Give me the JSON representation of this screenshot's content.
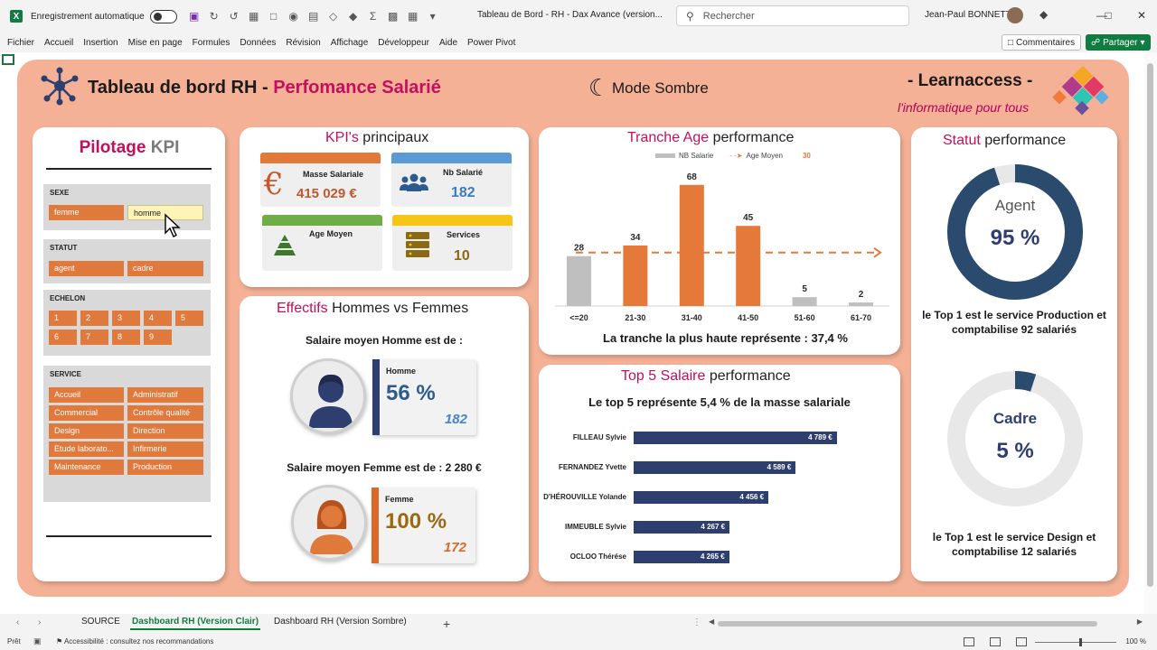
{
  "titlebar": {
    "autosave_label": "Enregistrement automatique",
    "doc_title": "Tableau de Bord - RH - Dax Avance (version...",
    "search_placeholder": "Rechercher",
    "user_name": "Jean-Paul BONNETTO"
  },
  "menu": {
    "items": [
      "Fichier",
      "Accueil",
      "Insertion",
      "Mise en page",
      "Formules",
      "Données",
      "Révision",
      "Affichage",
      "Développeur",
      "Aide",
      "Power Pivot"
    ],
    "comments_label": "Commentaires",
    "share_label": "Partager"
  },
  "header": {
    "title_main": "Tableau de bord RH - ",
    "title_accent": "Perfomance Salarié",
    "mode_label": "Mode Sombre",
    "brand_name": "- Learnaccess -",
    "brand_tagline": "l'informatique pour tous"
  },
  "pilotage": {
    "title_a": "Pilotage",
    "title_b": "KPI",
    "sexe": {
      "label": "SEXE",
      "options": [
        "femme",
        "homme"
      ],
      "selected": "homme"
    },
    "statut": {
      "label": "STATUT",
      "options": [
        "agent",
        "cadre"
      ]
    },
    "echelon": {
      "label": "ECHELON",
      "options": [
        "1",
        "2",
        "3",
        "4",
        "5",
        "6",
        "7",
        "8",
        "9"
      ]
    },
    "service": {
      "label": "SERVICE",
      "options": [
        "Accueil",
        "Administratif",
        "Commercial",
        "Contrôle qualité",
        "Design",
        "Direction",
        "Etude laborato...",
        "Infirmerie",
        "Maintenance",
        "Production"
      ]
    }
  },
  "kpi": {
    "title_a": "KPI's",
    "title_b": "principaux",
    "masse_label": "Masse Salariale",
    "masse_value": "415 029 €",
    "nb_label": "Nb Salarié",
    "nb_value": "182",
    "age_label": "Age Moyen",
    "services_label": "Services",
    "services_value": "10",
    "colors": {
      "masse": "#e0793a",
      "nb": "#5b9bd5",
      "age": "#70ad47",
      "services": "#f5c518"
    }
  },
  "effectifs": {
    "title_a": "Effectifs",
    "title_b": "Hommes vs Femmes",
    "homme_caption": "Salaire moyen Homme est de :",
    "femme_caption": "Salaire moyen Femme est de : 2 280 €",
    "homme_label": "Homme",
    "homme_pct": "56 %",
    "homme_count": "182",
    "femme_label": "Femme",
    "femme_pct": "100 %",
    "femme_count": "172"
  },
  "tranche": {
    "title_a": "Tranche Age",
    "title_b": "performance",
    "caption": "La tranche la plus haute représente : 37,4 %"
  },
  "top5": {
    "title_a": "Top 5 Salaire",
    "title_b": "performance",
    "subtitle": "Le top 5 représente 5,4 % de la masse salariale"
  },
  "statut": {
    "title_a": "Statut",
    "title_b": "performance",
    "agent_label": "Agent",
    "agent_pct": "95 %",
    "agent_caption_1": "le Top 1 est le service Production et",
    "agent_caption_2": "comptabilise 92 salariés",
    "cadre_label": "Cadre",
    "cadre_pct": "5 %",
    "cadre_caption_1": "le Top 1 est le service Design et",
    "cadre_caption_2": "comptabilise 12 salariés",
    "agent_fraction": 0.95,
    "cadre_fraction": 0.05
  },
  "chart_data": [
    {
      "type": "bar",
      "categories": [
        "<=20",
        "21-30",
        "31-40",
        "41-50",
        "51-60",
        "61-70"
      ],
      "series": [
        {
          "name": "NB Salarie",
          "values": [
            28,
            34,
            68,
            45,
            5,
            2
          ]
        },
        {
          "name": "Age Moyen",
          "values": [
            30,
            30,
            30,
            30,
            30,
            30
          ],
          "type": "line"
        }
      ],
      "legend": {
        "bar_label": "NB Salarie",
        "line_label": "Age Moyen",
        "line_value": "30"
      },
      "bar_colors": [
        "#bfbfbf",
        "#e5793a",
        "#e5793a",
        "#e5793a",
        "#bfbfbf",
        "#bfbfbf"
      ],
      "line_color": "#e07a3c",
      "ylim": [
        0,
        75
      ]
    },
    {
      "type": "bar",
      "orientation": "horizontal",
      "categories": [
        "FILLEAU Sylvie",
        "FERNANDEZ Yvette",
        "D'HÉROUVILLE Yolande",
        "IMMEUBLE Sylvie",
        "OCLOO Thérése"
      ],
      "values": [
        4789,
        4589,
        4456,
        4267,
        4265
      ],
      "value_labels": [
        "4 789 €",
        "4 589 €",
        "4 456 €",
        "4 267 €",
        "4 265 €"
      ],
      "xlim": [
        3800,
        4900
      ],
      "bar_color": "#2e3e6e"
    }
  ],
  "tabs": {
    "items": [
      "SOURCE",
      "Dashboard RH (Version Clair)",
      "Dashboard RH (Version Sombre)"
    ],
    "active": "Dashboard RH (Version Clair)"
  },
  "status": {
    "ready": "Prêt",
    "accessibility": "Accessibilité : consultez nos recommandations",
    "zoom": "100 %"
  }
}
